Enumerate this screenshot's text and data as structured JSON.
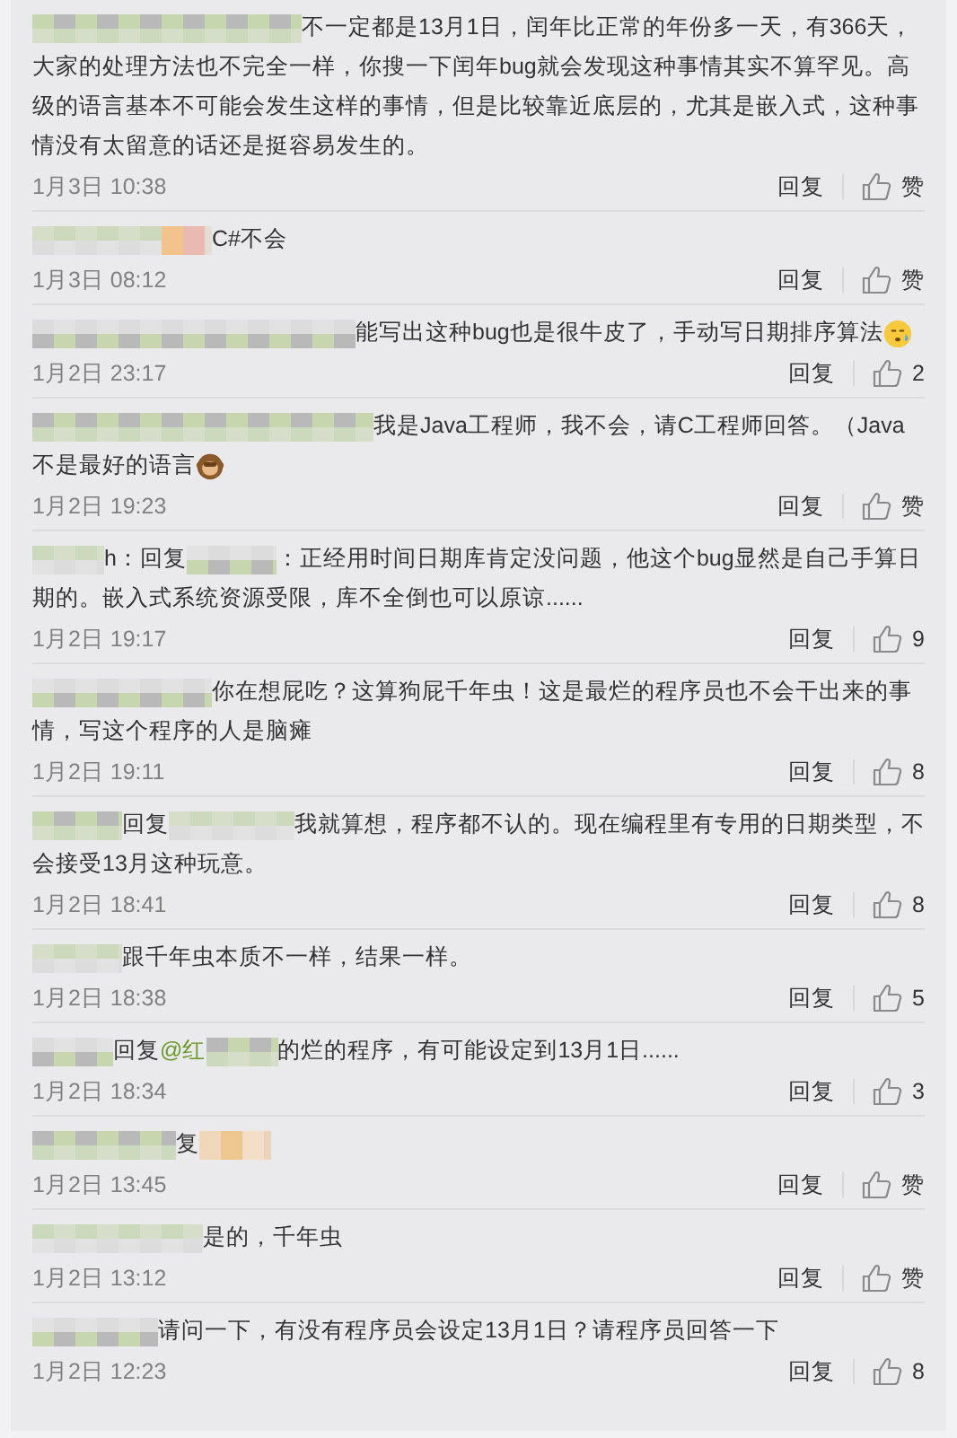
{
  "comments": [
    {
      "parts": [
        {
          "kind": "blur"
        },
        {
          "kind": "text",
          "text": "不一定都是13月1日，闰年比正常的年份多一天，有366天，大家的处理方法也不完全一样，你搜一下闰年bug就会发现这种事情其实不算罕见。高级的语言基本不可能会发生这样的事情，但是比较靠近底层的，尤其是嵌入式，这种事情没有太留意的话还是挺容易发生的。"
        }
      ],
      "time": "1月3日 10:38",
      "reply": "回复",
      "likes": "赞"
    },
    {
      "parts": [
        {
          "kind": "blur"
        },
        {
          "kind": "text",
          "text": "C#不会"
        }
      ],
      "time": "1月3日 08:12",
      "reply": "回复",
      "likes": "赞"
    },
    {
      "parts": [
        {
          "kind": "blur"
        },
        {
          "kind": "text",
          "text": "能写出这种bug也是很牛皮了，手动写日期排序算法"
        },
        {
          "kind": "emoji"
        }
      ],
      "time": "1月2日 23:17",
      "reply": "回复",
      "likes": "2"
    },
    {
      "parts": [
        {
          "kind": "blur"
        },
        {
          "kind": "text",
          "text": "我是Java工程师，我不会，请C工程师回答。（Java不是最好的语言"
        },
        {
          "kind": "emoji"
        }
      ],
      "time": "1月2日 19:23",
      "reply": "回复",
      "likes": "赞"
    },
    {
      "parts": [
        {
          "kind": "blur"
        },
        {
          "kind": "text",
          "text": "h：回复"
        },
        {
          "kind": "blur"
        },
        {
          "kind": "text",
          "text": "：正经用时间日期库肯定没问题，他这个bug显然是自己手算日期的。嵌入式系统资源受限，库不全倒也可以原谅......"
        }
      ],
      "time": "1月2日 19:17",
      "reply": "回复",
      "likes": "9"
    },
    {
      "parts": [
        {
          "kind": "blur"
        },
        {
          "kind": "text",
          "text": "你在想屁吃？这算狗屁千年虫！这是最烂的程序员也不会干出来的事情，写这个程序的人是脑瘫"
        }
      ],
      "time": "1月2日 19:11",
      "reply": "回复",
      "likes": "8"
    },
    {
      "parts": [
        {
          "kind": "blur"
        },
        {
          "kind": "text",
          "text": "回复"
        },
        {
          "kind": "blur"
        },
        {
          "kind": "text",
          "text": "我就算想，程序都不认的。现在编程里有专用的日期类型，不会接受13月这种玩意。"
        }
      ],
      "time": "1月2日 18:41",
      "reply": "回复",
      "likes": "8"
    },
    {
      "parts": [
        {
          "kind": "blur"
        },
        {
          "kind": "text",
          "text": "跟千年虫本质不一样，结果一样。"
        }
      ],
      "time": "1月2日 18:38",
      "reply": "回复",
      "likes": "5"
    },
    {
      "parts": [
        {
          "kind": "blur"
        },
        {
          "kind": "text",
          "text": "回复"
        },
        {
          "kind": "mention",
          "text": "@红"
        },
        {
          "kind": "blur"
        },
        {
          "kind": "text",
          "text": "的烂的程序，有可能设定到13月1日......"
        }
      ],
      "time": "1月2日 18:34",
      "reply": "回复",
      "likes": "3"
    },
    {
      "parts": [
        {
          "kind": "blur"
        },
        {
          "kind": "text",
          "text": "复"
        },
        {
          "kind": "blur"
        }
      ],
      "time": "1月2日 13:45",
      "reply": "回复",
      "likes": "赞"
    },
    {
      "parts": [
        {
          "kind": "blur"
        },
        {
          "kind": "text",
          "text": "是的，千年虫"
        }
      ],
      "time": "1月2日 13:12",
      "reply": "回复",
      "likes": "赞"
    },
    {
      "parts": [
        {
          "kind": "blur"
        },
        {
          "kind": "text",
          "text": "请问一下，有没有程序员会设定13月1日？请程序员回答一下"
        }
      ],
      "time": "1月2日 12:23",
      "reply": "回复",
      "likes": "8"
    }
  ]
}
